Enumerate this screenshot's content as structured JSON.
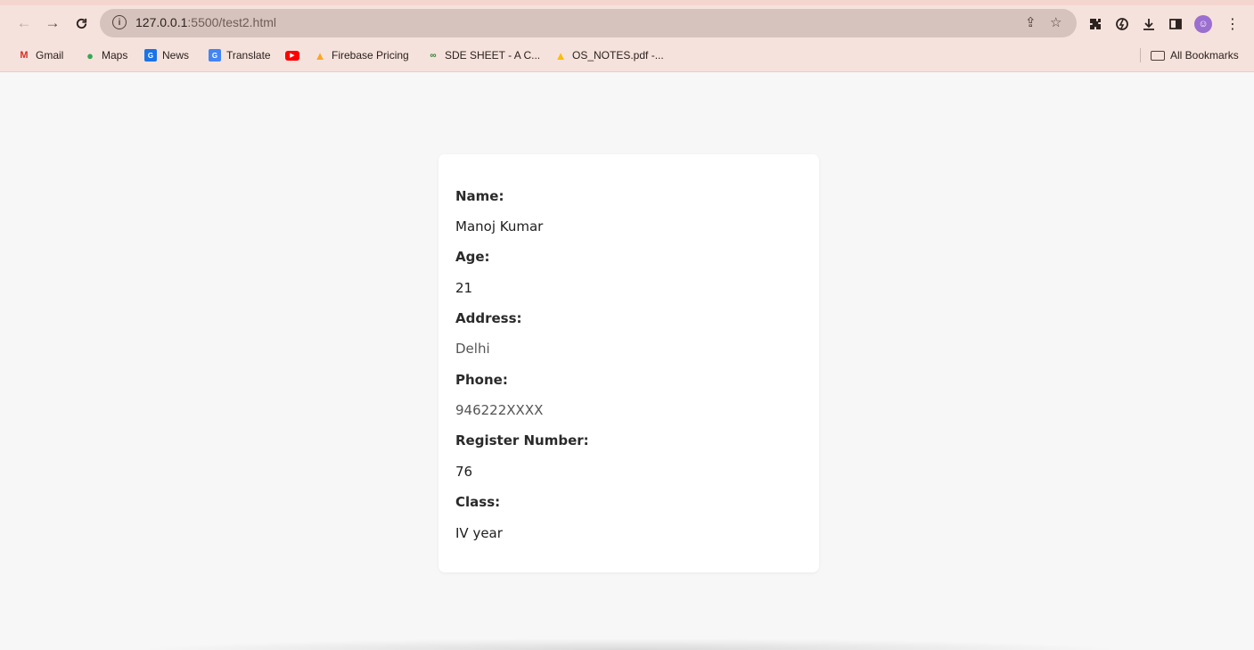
{
  "browser": {
    "url_host": "127.0.0.1",
    "url_rest": ":5500/test2.html",
    "bookmarks": [
      {
        "label": "Gmail",
        "icon": "gmail-icon",
        "color": "#d93025"
      },
      {
        "label": "Maps",
        "icon": "maps-icon",
        "color": "#34a853"
      },
      {
        "label": "News",
        "icon": "news-icon",
        "color": "#1a73e8"
      },
      {
        "label": "Translate",
        "icon": "translate-icon",
        "color": "#4285f4"
      },
      {
        "label": "",
        "icon": "youtube-icon",
        "color": "#ff0000"
      },
      {
        "label": "Firebase Pricing",
        "icon": "firebase-icon",
        "color": "#f9a825"
      },
      {
        "label": "SDE SHEET - A C...",
        "icon": "link-icon",
        "color": "#2e7d32"
      },
      {
        "label": "OS_NOTES.pdf -...",
        "icon": "drive-icon",
        "color": "#fbbc04"
      }
    ],
    "all_bookmarks": "All Bookmarks"
  },
  "card": {
    "name_label": "Name:",
    "name_value": "Manoj Kumar",
    "age_label": "Age:",
    "age_value": "21",
    "address_label": "Address:",
    "address_value": "Delhi",
    "phone_label": "Phone:",
    "phone_value": "946222XXXX",
    "register_label": "Register Number:",
    "register_value": "76",
    "class_label": "Class:",
    "class_value": "IV year"
  }
}
